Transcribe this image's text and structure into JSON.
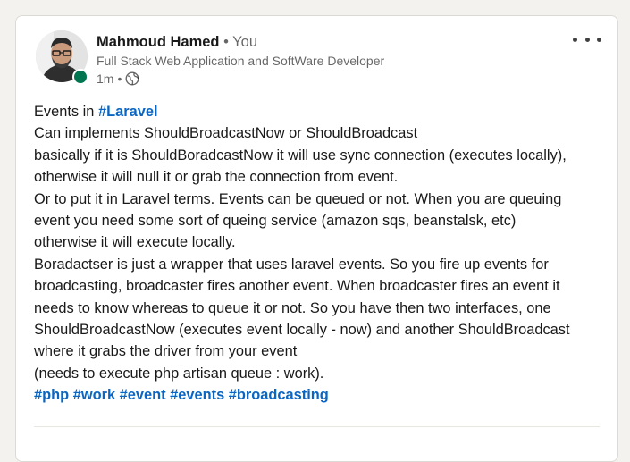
{
  "post": {
    "author_name": "Mahmoud Hamed",
    "separator": " • ",
    "you_label": "You",
    "headline": "Full Stack Web Application and SoftWare Developer",
    "time": "1m",
    "visibility_dot": "•",
    "visibility_icon": "globe-icon",
    "more_icon": "ellipsis-icon",
    "lines": {
      "l1_text": "Events in ",
      "l1_tag": "#Laravel",
      "l2": "Can implements ShouldBroadcastNow or ShouldBroadcast",
      "l3": "basically if it is ShouldBoradcastNow it will use sync connection (executes locally),",
      "l4": "otherwise it will null it or grab the connection from event.",
      "l5": "Or to put it in Laravel terms. Events can be queued or not. When you are queuing",
      "l6": "event you need some sort of queing service (amazon sqs, beanstalsk, etc)",
      "l7": "otherwise it will execute locally.",
      "l8": "Boradactser is just a wrapper that uses laravel events. So you fire up events for",
      "l9": "broadcasting, broadcaster fires another event. When broadcaster fires an event it",
      "l10": "needs to know whereas to queue it or not. So you have then two interfaces, one",
      "l11": "ShouldBroadcastNow (executes event locally - now) and another ShouldBroadcast",
      "l12": "where it grabs the driver from your event",
      "l13": "(needs to execute php artisan queue : work)."
    },
    "hashtags": [
      "#php",
      "#work",
      "#event",
      "#events",
      "#broadcasting"
    ]
  },
  "colors": {
    "link": "#0a66c2",
    "presence": "#01754f"
  }
}
